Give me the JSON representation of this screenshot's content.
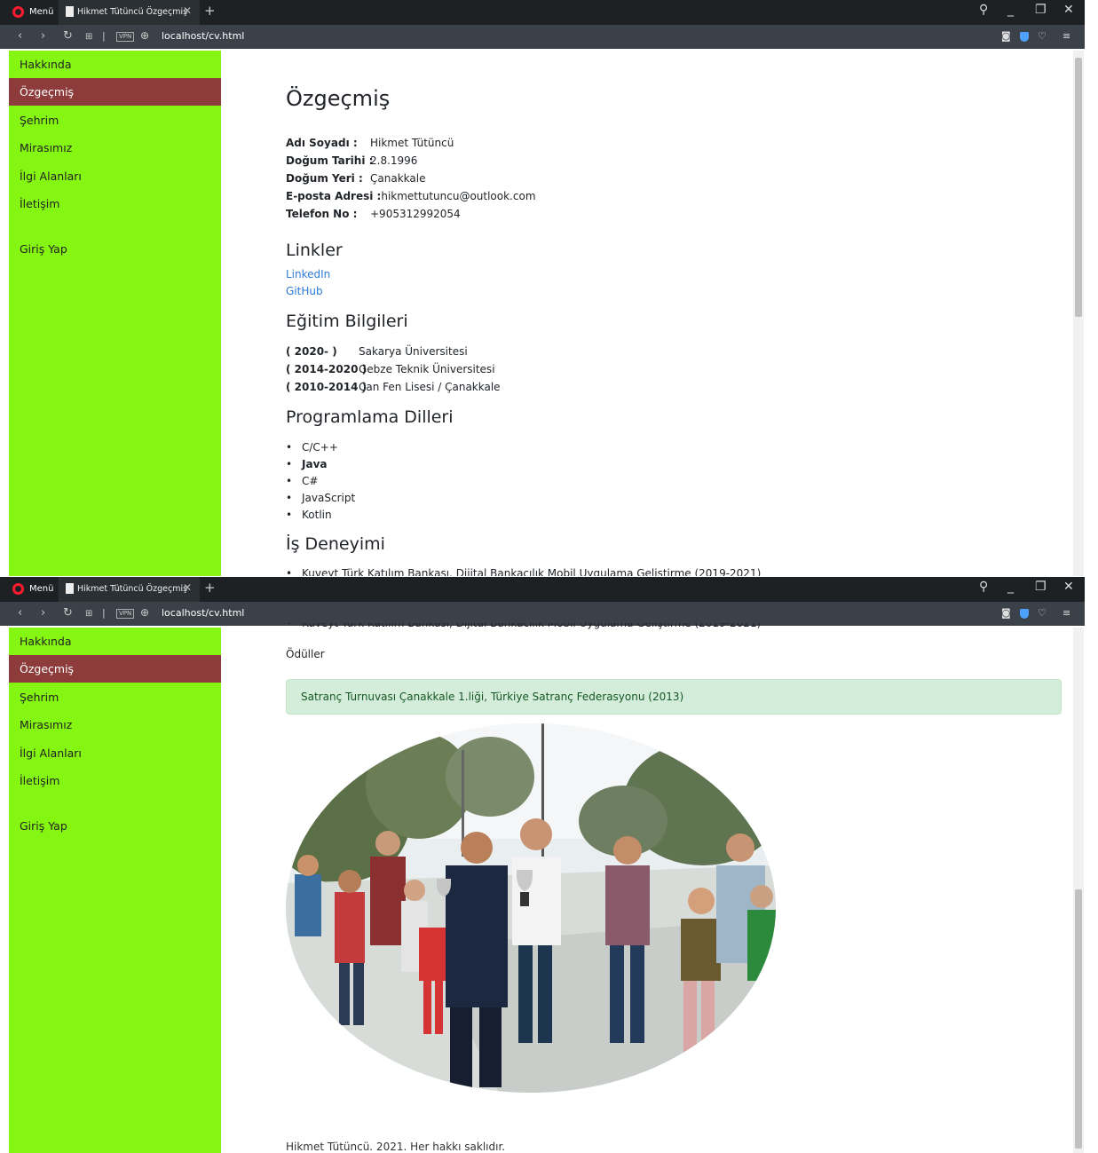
{
  "browser": {
    "menu_label": "Menü",
    "tab_title": "Hikmet Tütüncü Özgeçmiş",
    "url": "localhost/cv.html",
    "vpn": "VPN"
  },
  "sidebar": {
    "items": [
      {
        "label": "Hakkında"
      },
      {
        "label": "Özgeçmiş",
        "active": true
      },
      {
        "label": "Şehrim"
      },
      {
        "label": "Mirasımız"
      },
      {
        "label": "İlgi Alanları"
      },
      {
        "label": "İletişim"
      },
      {
        "label": "Giriş Yap"
      }
    ]
  },
  "page": {
    "title": "Özgeçmiş",
    "info": [
      {
        "label": "Adı Soyadı :",
        "value": "Hikmet Tütüncü"
      },
      {
        "label": "Doğum Tarihi :",
        "value": "2.8.1996"
      },
      {
        "label": "Doğum Yeri :",
        "value": "Çanakkale"
      },
      {
        "label": "E-posta Adresi :",
        "value": "hikmettutuncu@outlook.com"
      },
      {
        "label": "Telefon No :",
        "value": "+905312992054"
      }
    ],
    "links_heading": "Linkler",
    "links": [
      "LinkedIn",
      "GitHub"
    ],
    "education_heading": "Eğitim Bilgileri",
    "education": [
      {
        "years": "( 2020- )",
        "school": "Sakarya Üniversitesi"
      },
      {
        "years": "( 2014-2020 )",
        "school": "Gebze Teknik Üniversitesi"
      },
      {
        "years": "( 2010-2014 )",
        "school": "Çan Fen Lisesi / Çanakkale"
      }
    ],
    "languages_heading": "Programlama Dilleri",
    "languages": [
      {
        "name": "C/C++",
        "bold": false
      },
      {
        "name": "Java",
        "bold": true
      },
      {
        "name": "C#",
        "bold": false
      },
      {
        "name": "JavaScript",
        "bold": false
      },
      {
        "name": "Kotlin",
        "bold": false
      }
    ],
    "experience_heading": "İş Deneyimi",
    "experience": [
      "Kuveyt Türk Katılım Bankası, Dijital Bankacılık Mobil Uygulama Geliştirme (2019-2021)"
    ],
    "awards_heading": "Ödüller",
    "award": "Satranç Turnuvası Çanakkale 1.liği, Türkiye Satranç Federasyonu (2013)",
    "footer": "Hikmet Tütüncü. 2021. Her hakkı saklıdır."
  }
}
